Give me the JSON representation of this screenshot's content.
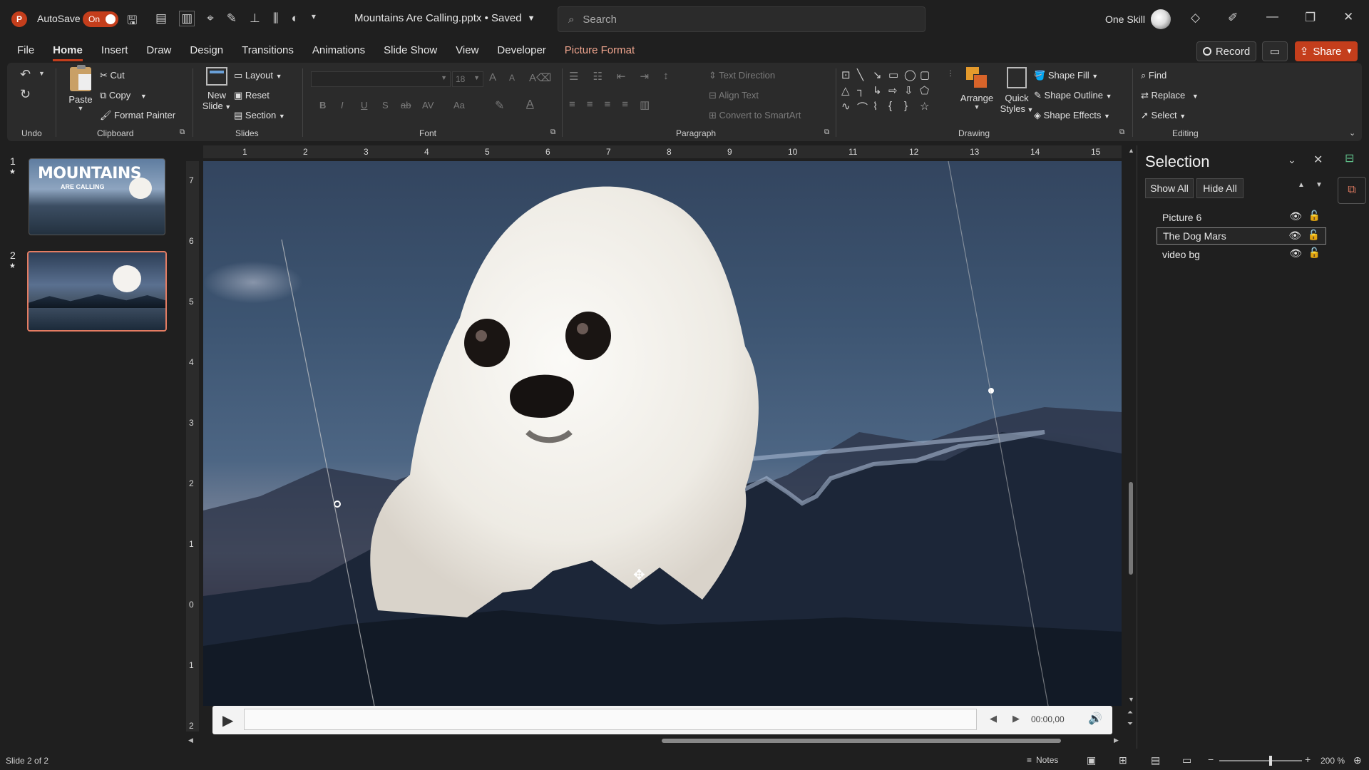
{
  "app": {
    "title": "Mountains Are Calling.pptx • Saved",
    "autosave_label": "AutoSave",
    "autosave_state": "On",
    "search_placeholder": "Search",
    "user_name": "One Skill",
    "accent": "#c43e1c"
  },
  "menu": {
    "tabs": [
      "File",
      "Home",
      "Insert",
      "Draw",
      "Design",
      "Transitions",
      "Animations",
      "Slide Show",
      "View",
      "Developer",
      "Picture Format"
    ],
    "active": "Home",
    "record_label": "Record",
    "share_label": "Share"
  },
  "ribbon": {
    "undo_group": "Undo",
    "clipboard": {
      "group": "Clipboard",
      "paste": "Paste",
      "cut": "Cut",
      "copy": "Copy",
      "format_painter": "Format Painter"
    },
    "slides": {
      "group": "Slides",
      "new_slide_1": "New",
      "new_slide_2": "Slide",
      "layout": "Layout",
      "reset": "Reset",
      "section": "Section"
    },
    "font": {
      "group": "Font",
      "size": "18",
      "bold": "B",
      "italic": "I",
      "underline": "U",
      "shadow": "S",
      "strike": "ab",
      "spacing": "AV",
      "case": "Aa",
      "grow": "A",
      "shrink": "A"
    },
    "paragraph": {
      "group": "Paragraph",
      "text_direction": "Text Direction",
      "align_text": "Align Text",
      "convert_smartart": "Convert to SmartArt"
    },
    "drawing": {
      "group": "Drawing",
      "arrange": "Arrange",
      "quick_styles_1": "Quick",
      "quick_styles_2": "Styles",
      "shape_fill": "Shape Fill",
      "shape_outline": "Shape Outline",
      "shape_effects": "Shape Effects"
    },
    "editing": {
      "group": "Editing",
      "find": "Find",
      "replace": "Replace",
      "select": "Select"
    }
  },
  "thumbnails": [
    {
      "number": "1",
      "title_1": "MOUNTAINS",
      "title_2": "ARE CALLING"
    },
    {
      "number": "2"
    }
  ],
  "ruler": {
    "h": [
      "1",
      "2",
      "3",
      "4",
      "5",
      "6",
      "7",
      "8",
      "9",
      "10",
      "11",
      "12",
      "13",
      "14",
      "15"
    ],
    "v": [
      "7",
      "6",
      "5",
      "4",
      "3",
      "2",
      "1",
      "0",
      "1",
      "2"
    ]
  },
  "media": {
    "time": "00:00,00"
  },
  "selection_pane": {
    "title": "Selection",
    "show_all": "Show All",
    "hide_all": "Hide All",
    "items": [
      "Picture 6",
      "The Dog Mars",
      "video bg"
    ],
    "active_index": 1
  },
  "status": {
    "slide_info": "Slide 2 of 2",
    "notes": "Notes",
    "zoom": "200 %"
  }
}
